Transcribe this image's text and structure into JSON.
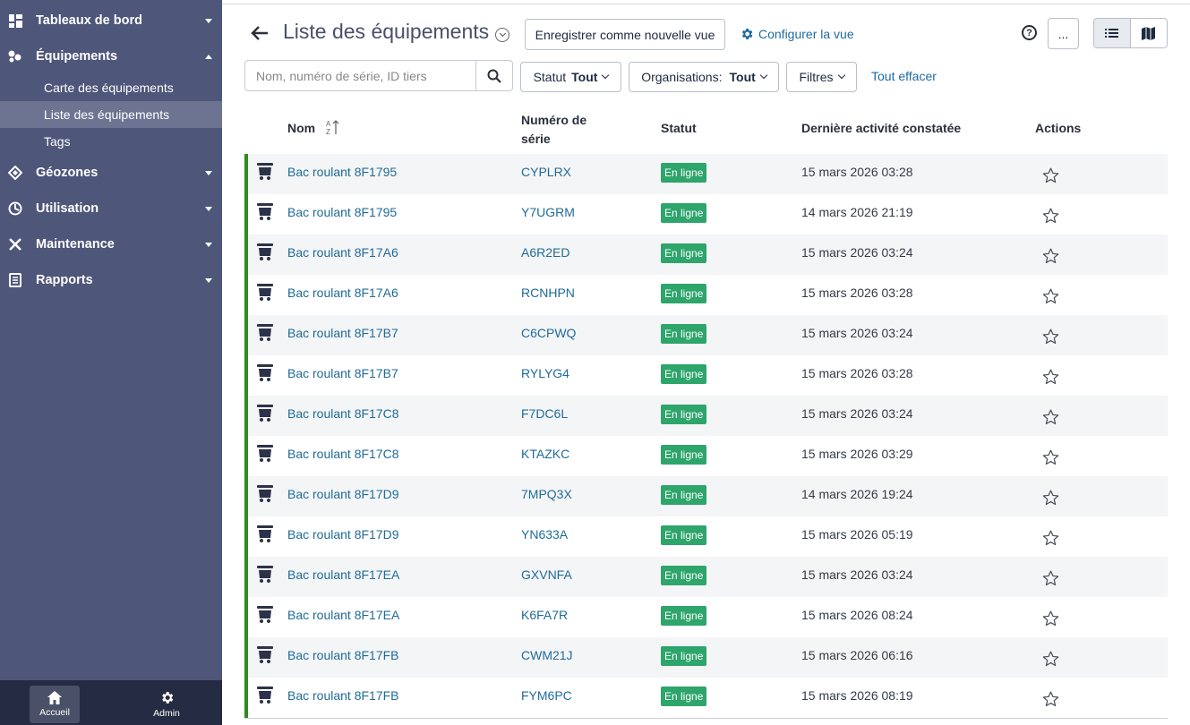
{
  "sidebar": {
    "items": [
      {
        "label": "Tableaux de bord",
        "icon": "dashboard-icon"
      },
      {
        "label": "Équipements",
        "icon": "equipment-icon"
      },
      {
        "label": "Géozones",
        "icon": "geozone-icon"
      },
      {
        "label": "Utilisation",
        "icon": "utilisation-icon"
      },
      {
        "label": "Maintenance",
        "icon": "maintenance-icon"
      },
      {
        "label": "Rapports",
        "icon": "reports-icon"
      }
    ],
    "sub_items": [
      "Carte des équipements",
      "Liste des équipements",
      "Tags"
    ],
    "active_sub": "Liste des équipements",
    "bottom": {
      "home": "Accueil",
      "admin": "Admin"
    }
  },
  "header": {
    "title": "Liste des équipements",
    "save_view": "Enregistrer comme nouvelle vue",
    "configure_view": "Configurer la vue",
    "more": "...",
    "help": "?"
  },
  "filters": {
    "search_placeholder": "Nom, numéro de série, ID tiers",
    "status_label": "Statut",
    "status_value": "Tout",
    "org_label": "Organisations:",
    "org_value": "Tout",
    "filters_label": "Filtres",
    "clear_all": "Tout effacer"
  },
  "table": {
    "columns": {
      "name": "Nom",
      "serial_1": "Numéro de",
      "serial_2": "série",
      "status": "Statut",
      "last_activity": "Dernière activité constatée",
      "actions": "Actions"
    },
    "rows": [
      {
        "name": "Bac roulant 8F1795",
        "serial": "CYPLRX",
        "status": "En ligne",
        "date": "15 mars 2026 03:28"
      },
      {
        "name": "Bac roulant 8F1795",
        "serial": "Y7UGRM",
        "status": "En ligne",
        "date": "14 mars 2026 21:19"
      },
      {
        "name": "Bac roulant 8F17A6",
        "serial": "A6R2ED",
        "status": "En ligne",
        "date": "15 mars 2026 03:24"
      },
      {
        "name": "Bac roulant 8F17A6",
        "serial": "RCNHPN",
        "status": "En ligne",
        "date": "15 mars 2026 03:28"
      },
      {
        "name": "Bac roulant 8F17B7",
        "serial": "C6CPWQ",
        "status": "En ligne",
        "date": "15 mars 2026 03:24"
      },
      {
        "name": "Bac roulant 8F17B7",
        "serial": "RYLYG4",
        "status": "En ligne",
        "date": "15 mars 2026 03:28"
      },
      {
        "name": "Bac roulant 8F17C8",
        "serial": "F7DC6L",
        "status": "En ligne",
        "date": "15 mars 2026 03:24"
      },
      {
        "name": "Bac roulant 8F17C8",
        "serial": "KTAZKC",
        "status": "En ligne",
        "date": "15 mars 2026 03:29"
      },
      {
        "name": "Bac roulant 8F17D9",
        "serial": "7MPQ3X",
        "status": "En ligne",
        "date": "14 mars 2026 19:24"
      },
      {
        "name": "Bac roulant 8F17D9",
        "serial": "YN633A",
        "status": "En ligne",
        "date": "15 mars 2026 05:19"
      },
      {
        "name": "Bac roulant 8F17EA",
        "serial": "GXVNFA",
        "status": "En ligne",
        "date": "15 mars 2026 03:24"
      },
      {
        "name": "Bac roulant 8F17EA",
        "serial": "K6FA7R",
        "status": "En ligne",
        "date": "15 mars 2026 08:24"
      },
      {
        "name": "Bac roulant 8F17FB",
        "serial": "CWM21J",
        "status": "En ligne",
        "date": "15 mars 2026 06:16"
      },
      {
        "name": "Bac roulant 8F17FB",
        "serial": "FYM6PC",
        "status": "En ligne",
        "date": "15 mars 2026 08:19"
      }
    ]
  },
  "colors": {
    "sidebar_bg": "#4e5679",
    "sidebar_active": "#6d7491",
    "bottom_bar": "#252b42",
    "link": "#1f6b99",
    "online_badge": "#2da56b",
    "row_indicator": "#2e8b1f"
  }
}
